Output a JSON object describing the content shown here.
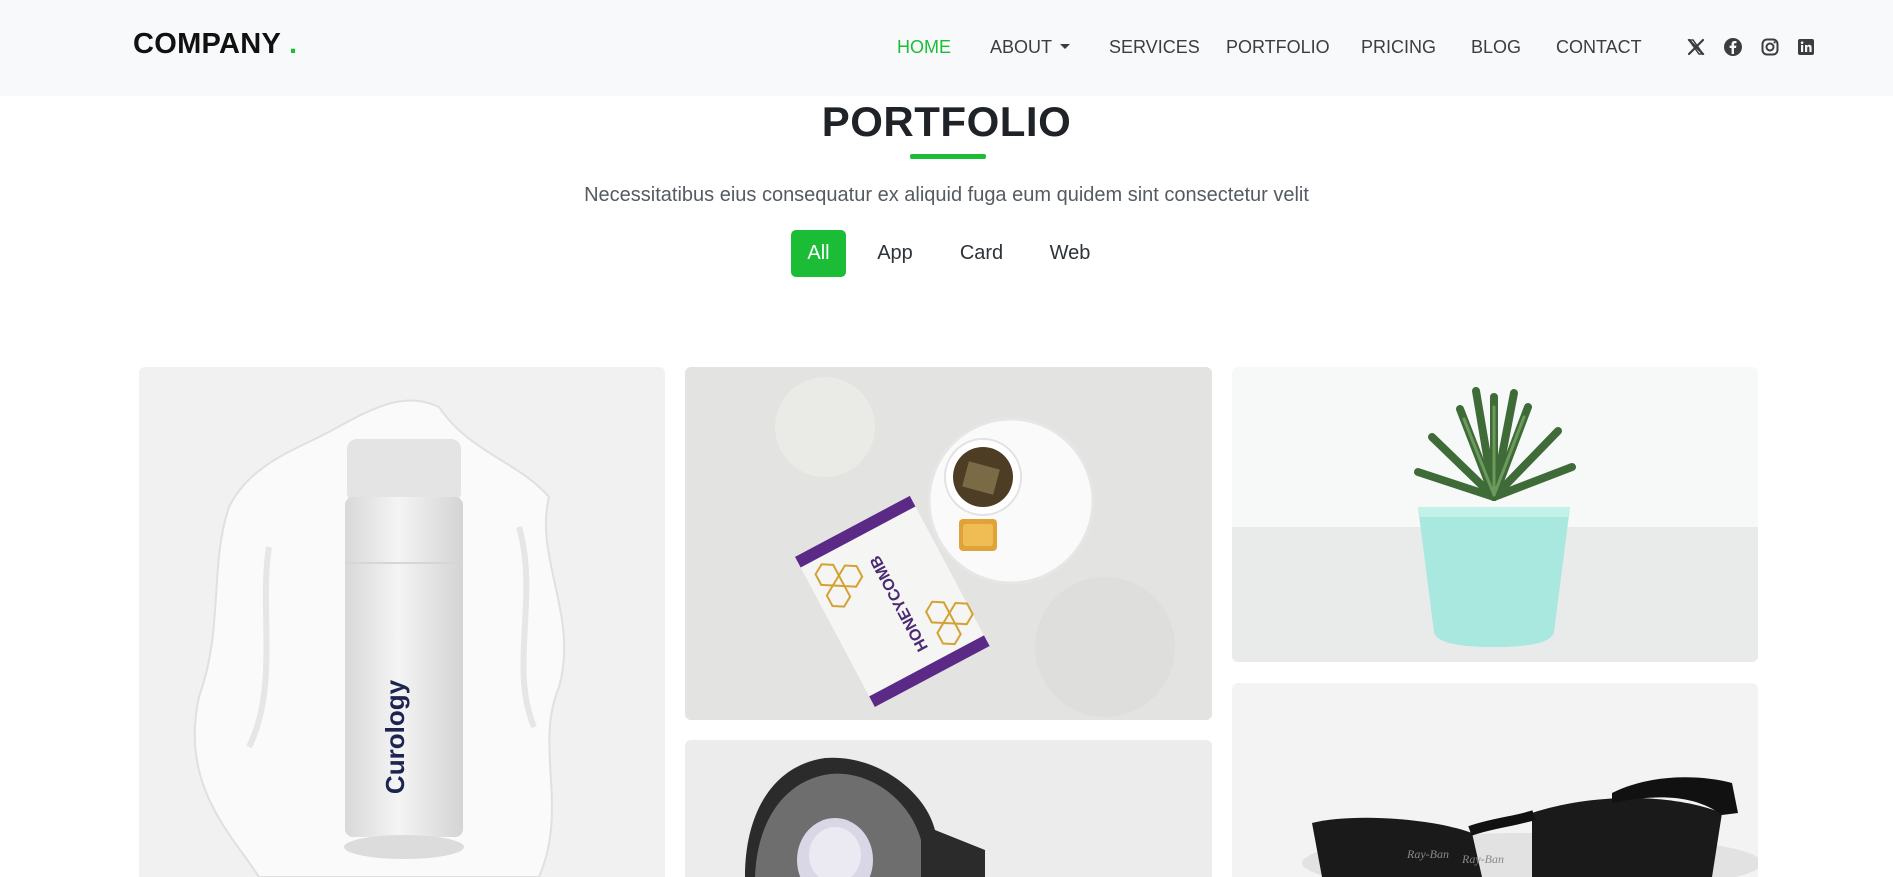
{
  "header": {
    "logo": "COMPANY",
    "logo_dot": ".",
    "nav": [
      {
        "label": "HOME",
        "active": true
      },
      {
        "label": "ABOUT",
        "dropdown": true
      },
      {
        "label": "SERVICES"
      },
      {
        "label": "PORTFOLIO"
      },
      {
        "label": "PRICING"
      },
      {
        "label": "BLOG"
      },
      {
        "label": "CONTACT"
      }
    ],
    "social": [
      "x-icon",
      "facebook-icon",
      "instagram-icon",
      "linkedin-icon"
    ]
  },
  "section": {
    "title": "PORTFOLIO",
    "subtitle": "Necessitatibus eius consequatur ex aliquid fuga eum quidem sint consectetur velit"
  },
  "filters": [
    {
      "label": "All",
      "active": true
    },
    {
      "label": "App"
    },
    {
      "label": "Card"
    },
    {
      "label": "Web"
    }
  ],
  "portfolio": {
    "items": [
      {
        "name": "skincare-bottle-image",
        "product_text": "Curology"
      },
      {
        "name": "honeycomb-tea-image",
        "product_text": "HONEYCOMB"
      },
      {
        "name": "potted-succulent-image"
      },
      {
        "name": "lamp-image"
      },
      {
        "name": "sunglasses-image",
        "brand_text": "Ray-Ban"
      }
    ]
  },
  "colors": {
    "accent": "#1bbd36",
    "header_bg": "#f8f9fa",
    "text": "#212529"
  }
}
